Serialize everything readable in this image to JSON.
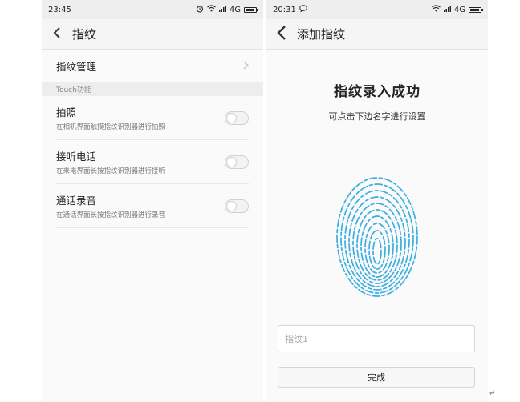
{
  "left_screen": {
    "status": {
      "time": "23:45",
      "network": "4G"
    },
    "title": "指纹",
    "manage_label": "指纹管理",
    "section_header": "Touch功能",
    "settings": [
      {
        "title": "拍照",
        "desc": "在相机界面触摸指纹识别器进行拍照",
        "enabled": false
      },
      {
        "title": "接听电话",
        "desc": "在来电界面长按指纹识别器进行接听",
        "enabled": false
      },
      {
        "title": "通话录音",
        "desc": "在通话界面长按指纹识别器进行录音",
        "enabled": false
      }
    ]
  },
  "right_screen": {
    "status": {
      "time": "20:31",
      "network": "4G"
    },
    "title": "添加指纹",
    "success_title": "指纹录入成功",
    "success_subtitle": "可点击下边名字进行设置",
    "name_placeholder": "指纹1",
    "done_label": "完成"
  },
  "colors": {
    "fingerprint": "#3aaee0",
    "background": "#fafafa",
    "statusbar": "#eeeeee"
  },
  "icons": [
    "alarm-icon",
    "wifi-icon",
    "signal-icon",
    "battery-icon",
    "back-arrow-icon",
    "chevron-right-icon",
    "message-icon",
    "fingerprint-icon"
  ]
}
